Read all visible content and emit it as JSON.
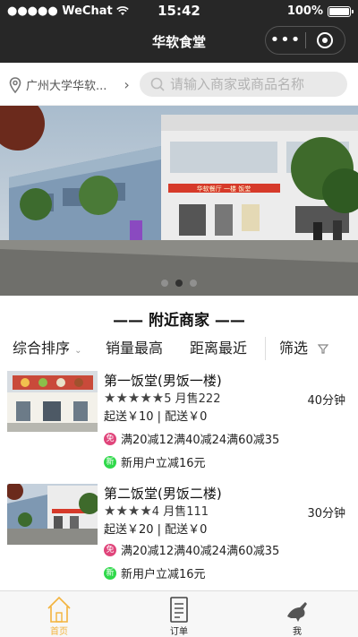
{
  "status_bar": {
    "carrier": "●●●●● WeChat",
    "time": "15:42",
    "battery": "100%"
  },
  "nav": {
    "title": "华软食堂"
  },
  "location": {
    "text": "广州大学华软..."
  },
  "search": {
    "placeholder": "请输入商家或商品名称"
  },
  "banner": {
    "sign_text": "华软餐厅 一楼 饭堂",
    "page_count": 3,
    "active_index": 1
  },
  "section_title": "—— 附近商家 ——",
  "sort_options": [
    {
      "label": "综合排序"
    },
    {
      "label": "销量最高"
    },
    {
      "label": "距离最近"
    },
    {
      "label": "筛选"
    }
  ],
  "shops": [
    {
      "name": "第一饭堂(男饭一楼)",
      "stars": "★★★★★",
      "monthly_sales": "5 月售222",
      "time": "40分钟",
      "fees": "起送￥10 | 配送￥0",
      "promo_discount": "满20减12满40减24满60减35",
      "promo_new": "新用户立减16元",
      "badge_discount": "免",
      "badge_new": "新"
    },
    {
      "name": "第二饭堂(男饭二楼)",
      "stars": "★★★★",
      "monthly_sales": "4 月售111",
      "time": "30分钟",
      "fees": "起送￥20 | 配送￥0",
      "promo_discount": "满20减12满40减24满60减35",
      "promo_new": "新用户立减16元",
      "badge_discount": "免",
      "badge_new": "新"
    }
  ],
  "tabbar": [
    {
      "label": "首页",
      "icon": "home-icon",
      "active": true
    },
    {
      "label": "订单",
      "icon": "order-icon",
      "active": false
    },
    {
      "label": "我",
      "icon": "profile-icon",
      "active": false
    }
  ],
  "colors": {
    "nav_bg": "#272727",
    "tab_active": "#f3b33d",
    "badge_red": "#e0457b",
    "badge_green": "#2fd94a"
  }
}
